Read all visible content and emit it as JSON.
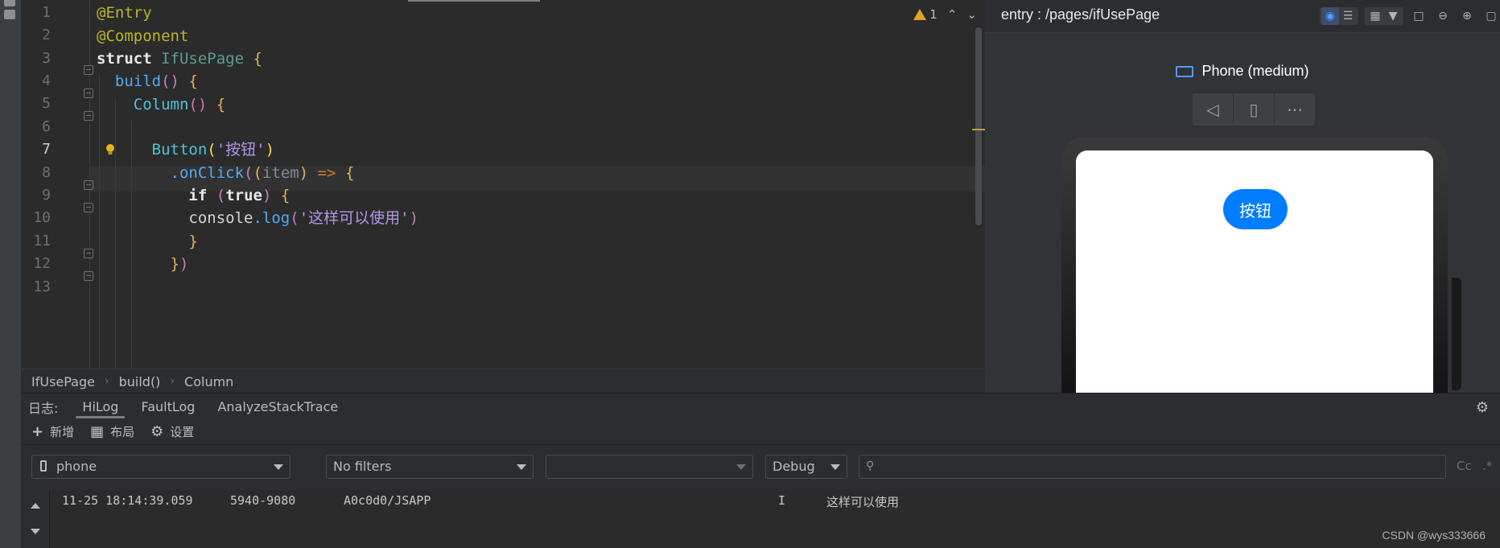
{
  "editor": {
    "line_numbers": [
      "1",
      "2",
      "3",
      "4",
      "5",
      "6",
      "7",
      "8",
      "9",
      "10",
      "11",
      "12",
      "13"
    ],
    "lines": {
      "l1": "@Entry",
      "l2": "@Component",
      "l3_kw": "struct",
      "l3_name": "IfUsePage",
      "l4_fn": "build",
      "l5_fn": "Column",
      "l7_fn": "Button",
      "l7_str": "'按钮'",
      "l8_fn": ".onClick",
      "l8_param": "item",
      "l8_arrow": "=>",
      "l9_if": "if",
      "l9_true": "true",
      "l10_obj": "console",
      "l10_fn": ".log",
      "l10_str": "'这样可以使用'"
    },
    "warning_count": "1"
  },
  "breadcrumb": [
    "IfUsePage",
    "build()",
    "Column"
  ],
  "preview": {
    "path": "entry : /pages/ifUsePage",
    "device": "Phone (medium)",
    "button_label": "按钮"
  },
  "log": {
    "label": "日志:",
    "tabs": [
      "HiLog",
      "FaultLog",
      "AnalyzeStackTrace"
    ],
    "toolbar": {
      "add": "新增",
      "layout": "布局",
      "settings": "设置"
    },
    "filters": {
      "device": "phone",
      "filter": "No filters",
      "process": "",
      "level": "Debug",
      "search_placeholder": ""
    },
    "case_toggle": "Cc",
    "regex_toggle": ".*",
    "entry": {
      "time": "11-25 18:14:39.059",
      "pid": "5940-9080",
      "tag": "A0c0d0/JSAPP",
      "level": "I",
      "message": "这样可以使用"
    }
  },
  "watermark": "CSDN @wys333666",
  "colors": {
    "accent": "#007dff",
    "warning": "#e0a328"
  }
}
